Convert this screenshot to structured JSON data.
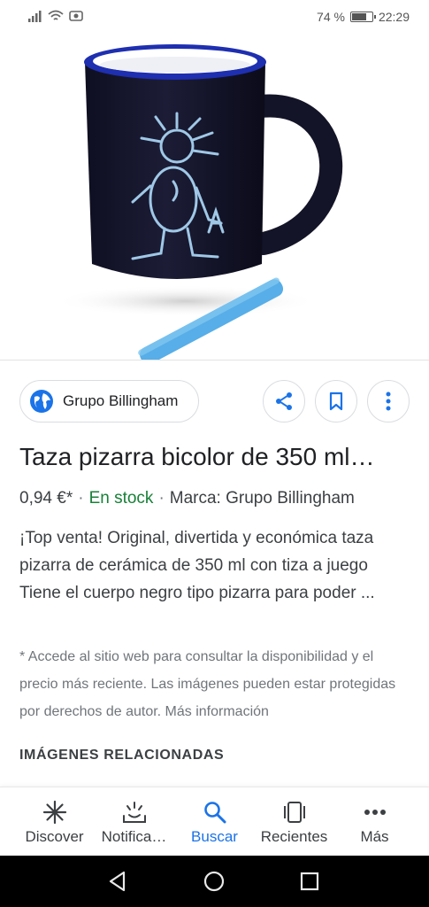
{
  "status_bar": {
    "battery_percent_text": "74 %",
    "battery_level": 0.74,
    "time": "22:29"
  },
  "product": {
    "image_icon": "chalkboard-mug-image",
    "source_name": "Grupo Billingham",
    "title": "Taza pizarra bicolor de 350 ml…",
    "price": "0,94 €*",
    "stock": "En stock",
    "brand": "Marca: Grupo Billingham",
    "description": "¡Top venta! Original, divertida y económica taza pizarra de cerámica de 350 ml con tiza a juego Tiene el cuerpo negro tipo pizarra para poder ...",
    "disclaimer": "* Accede al sitio web para consultar la disponibilidad y el precio más reciente. Las imágenes pueden estar protegidas por derechos de autor. Más información",
    "related_heading": "IMÁGENES RELACIONADAS"
  },
  "nav": {
    "items": [
      {
        "label": "Discover",
        "icon": "asterisk-icon"
      },
      {
        "label": "Notifica…",
        "icon": "notifications-icon"
      },
      {
        "label": "Buscar",
        "icon": "search-icon"
      },
      {
        "label": "Recientes",
        "icon": "recents-icon"
      },
      {
        "label": "Más",
        "icon": "more-icon"
      }
    ],
    "active_index": 2
  },
  "colors": {
    "accent": "#1a73e8",
    "stock_green": "#188038",
    "text_primary": "#202124",
    "text_secondary": "#70757a"
  }
}
